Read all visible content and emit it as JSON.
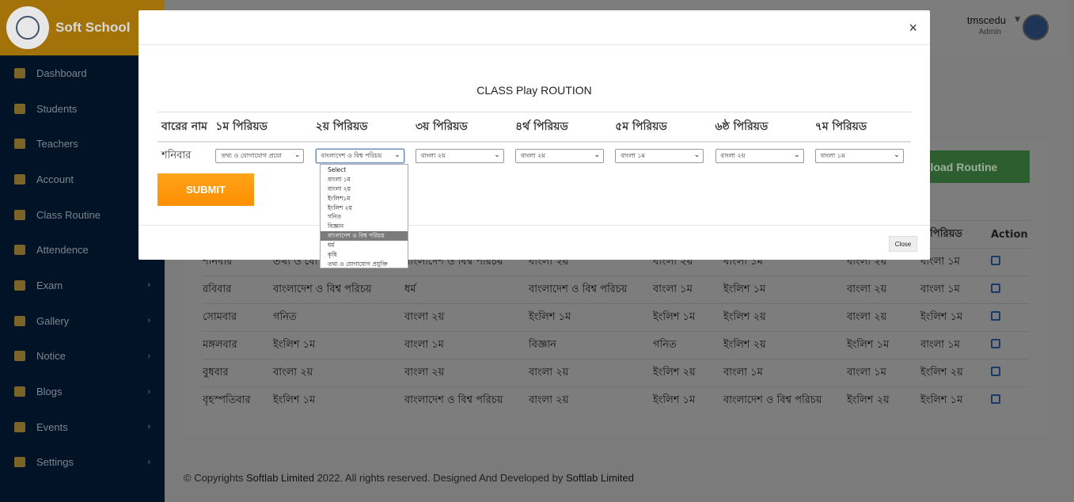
{
  "brand": {
    "name": "Soft School"
  },
  "sidebar": {
    "items": [
      {
        "label": "Dashboard",
        "icon": "dashboard-icon",
        "chevron": false
      },
      {
        "label": "Students",
        "icon": "students-icon",
        "chevron": false
      },
      {
        "label": "Teachers",
        "icon": "teachers-icon",
        "chevron": false
      },
      {
        "label": "Account",
        "icon": "account-icon",
        "chevron": false
      },
      {
        "label": "Class Routine",
        "icon": "calendar-icon",
        "chevron": false
      },
      {
        "label": "Attendence",
        "icon": "attendance-icon",
        "chevron": false
      },
      {
        "label": "Exam",
        "icon": "exam-icon",
        "chevron": true
      },
      {
        "label": "Gallery",
        "icon": "gallery-icon",
        "chevron": true
      },
      {
        "label": "Notice",
        "icon": "notice-icon",
        "chevron": true
      },
      {
        "label": "Blogs",
        "icon": "blogs-icon",
        "chevron": true
      },
      {
        "label": "Events",
        "icon": "events-icon",
        "chevron": true
      },
      {
        "label": "Settings",
        "icon": "settings-icon",
        "chevron": true
      }
    ]
  },
  "user": {
    "name": "tmscedu",
    "role": "Admin"
  },
  "download_button": "nload Routine",
  "routine_table": {
    "headers": [
      "",
      "",
      "",
      "",
      "",
      "",
      "",
      "য় পিরিয়ড",
      "Action"
    ],
    "rows": [
      [
        "শনিবার",
        "তথ্য ও যো",
        "বাংলাদেশ ও বিশ্ব পরিচয়",
        "বাংলা ২য়",
        "বাংলা ২য়",
        "বাংলা ১ম",
        "বাংলা ২য়",
        "বাংলা ১ম"
      ],
      [
        "রবিবার",
        "বাংলাদেশ ও বিশ্ব পরিচয়",
        "ধর্ম",
        "বাংলাদেশ ও বিশ্ব পরিচয়",
        "বাংলা ১ম",
        "ইংলিশ ১ম",
        "বাংলা ২য়",
        "বাংলা ১ম"
      ],
      [
        "সোমবার",
        "গনিত",
        "বাংলা ২য়",
        "ইংলিশ ১ম",
        "ইংলিশ ১ম",
        "ইংলিশ ২য়",
        "বাংলা ২য়",
        "ইংলিশ ১ম"
      ],
      [
        "মঙ্গলবার",
        "ইংলিশ ১ম",
        "বাংলা ১ম",
        "বিজ্ঞান",
        "গনিত",
        "ইংলিশ ২য়",
        "ইংলিশ ১ম",
        "বাংলা ১ম"
      ],
      [
        "বুধবার",
        "বাংলা ২য়",
        "বাংলা ২য়",
        "বাংলা ২য়",
        "ইংলিশ ২য়",
        "বাংলা ১ম",
        "বাংলা ১ম",
        "ইংলিশ ২য়"
      ],
      [
        "বৃহস্পতিবার",
        "ইংলিশ ১ম",
        "বাংলাদেশ ও বিশ্ব পরিচয়",
        "বাংলা ২য়",
        "ইংলিশ ১ম",
        "বাংলাদেশ ও বিশ্ব পরিচয়",
        "ইংলিশ ২য়",
        "ইংলিশ ১ম"
      ]
    ]
  },
  "footer": {
    "prefix": "© Copyrights ",
    "company": "Softlab Limited",
    "middle": " 2022. All rights reserved. Designed And Developed by ",
    "company2": "Softlab Limited"
  },
  "modal": {
    "close_symbol": "×",
    "title": "CLASS Play ROUTION",
    "headers": [
      "বারের নাম",
      "১ম পিরিয়ড",
      "২য় পিরিয়ড",
      "৩য় পিরিয়ড",
      "৪র্থ পিরিয়ড",
      "৫ম পিরিয়ড",
      "৬ষ্ঠ পিরিয়ড",
      "৭ম পিরিয়ড"
    ],
    "day": "শনিবার",
    "selects": [
      "তথ্য ও যোগাযোগ প্রযো",
      "বাংলাদেশ ও বিশ্ব পরিচয়",
      "বাংলা ২য়",
      "বাংলা ২য়",
      "বাংলা ১ম",
      "বাংলা ২য়",
      "বাংলা ১ম"
    ],
    "submit": "SUBMIT",
    "close_button": "Close",
    "dropdown_options": [
      "Select",
      "বাংলা ১ম",
      "বাংলা ২য়",
      "ইংলিশ১ম",
      "ইংলিশ ২য়",
      "গনিত",
      "বিজ্ঞান",
      "বাংলাদেশ ও বিশ্ব পরিচয়",
      "ধর্ম",
      "কৃষি",
      "তথ্য ও যোগাযোগ প্রযুক্তি"
    ],
    "dropdown_highlighted": "বাংলাদেশ ও বিশ্ব পরিচয়"
  },
  "colors": {
    "accent": "#ff9800",
    "sidebar": "#021327",
    "brand_bar": "#a3730a",
    "download_green": "#43a047"
  }
}
